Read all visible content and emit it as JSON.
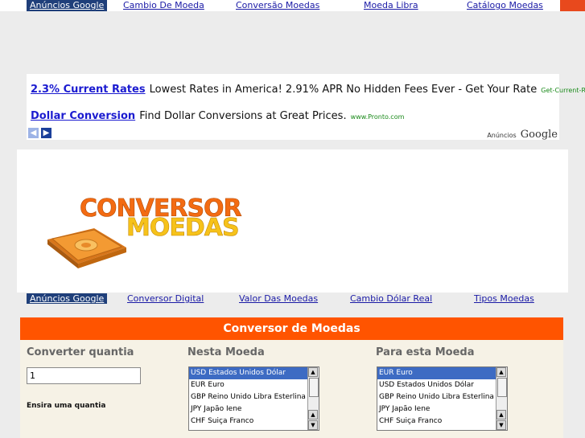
{
  "top_nav": {
    "ads_label": "Anúncios Google",
    "links": [
      "Cambio De Moeda",
      "Conversão Moedas",
      "Moeda Libra",
      "Catálogo Moedas"
    ]
  },
  "ad_unit": {
    "ads": [
      {
        "title": "2.3% Current Rates",
        "text": "Lowest Rates in America! 2.91% APR No Hidden Fees Ever - Get Your Rate",
        "url": "Get-Current-Rates...."
      },
      {
        "title": "Dollar Conversion",
        "text": "Find Dollar Conversions at Great Prices.",
        "url": "www.Pronto.com"
      }
    ],
    "attribution_prefix": "Anúncios",
    "attribution_brand": "Google",
    "prev_icon": "chevron-left-icon",
    "next_icon": "chevron-right-icon"
  },
  "logo": {
    "line1": "CONVERSOR",
    "line2": "MOEDAS"
  },
  "second_nav": {
    "ads_label": "Anúncios Google",
    "links": [
      "Conversor Digital",
      "Valor Das Moedas",
      "Cambio Dólar Real",
      "Tipos Moedas"
    ]
  },
  "converter": {
    "title": "Conversor de Moedas",
    "amount_label": "Converter quantia",
    "amount_value": "1",
    "amount_hint": "Ensira uma quantia",
    "from_label": "Nesta Moeda",
    "to_label": "Para esta Moeda",
    "from_options": [
      "USD Estados Unidos Dólar",
      "EUR Euro",
      "GBP Reino Unido Libra Esterlina",
      "JPY Japão Iene",
      "CHF Suiça Franco"
    ],
    "to_options": [
      "EUR Euro",
      "USD Estados Unidos Dólar",
      "GBP Reino Unido Libra Esterlina",
      "JPY Japão Iene",
      "CHF Suiça Franco"
    ],
    "from_selected": 0,
    "to_selected": 0
  },
  "colors": {
    "accent": "#ff5400",
    "ads_badge": "#1f3f7a",
    "link": "#1a1aa6",
    "ad_title": "#1b1bd0",
    "ad_url": "#1a8a1a",
    "logo_orange": "#f36b12",
    "logo_yellow": "#f6c21a"
  }
}
